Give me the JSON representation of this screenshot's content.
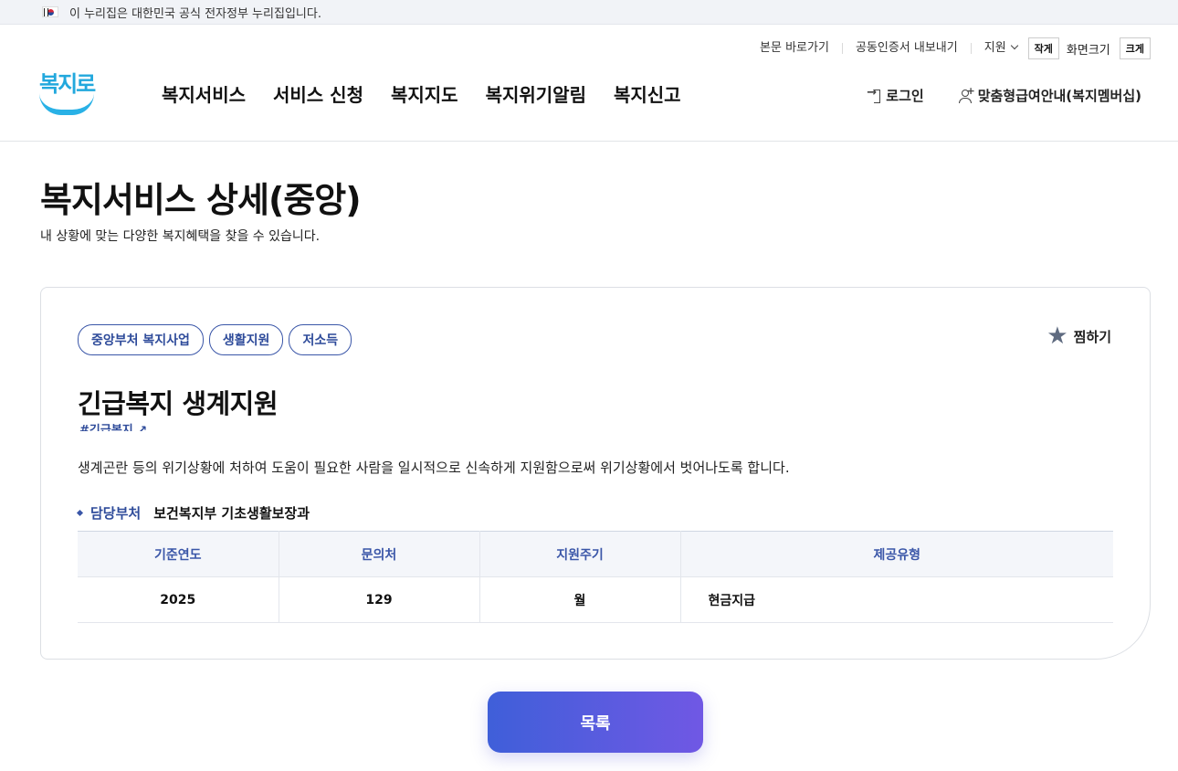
{
  "gov_banner": {
    "text": "이 누리집은 대한민국 공식 전자정부 누리집입니다."
  },
  "utility": {
    "skip": "본문 바로가기",
    "cert": "공동인증서 내보내기",
    "support": "지원",
    "small": "작게",
    "screen_size": "화면크기",
    "large": "크게"
  },
  "logo": {
    "text": "복지로"
  },
  "nav": [
    "복지서비스",
    "서비스 신청",
    "복지지도",
    "복지위기알림",
    "복지신고"
  ],
  "member": {
    "login": "로그인",
    "membership": "맞춤형급여안내(복지멤버십)"
  },
  "page": {
    "title": "복지서비스 상세(중앙)",
    "subtitle": "내 상황에 맞는 다양한 복지혜택을 찾을 수 있습니다."
  },
  "service": {
    "tags": [
      "중앙부처 복지사업",
      "생활지원",
      "저소득"
    ],
    "favorite": "찜하기",
    "title": "긴급복지 생계지원",
    "hashtag": "#긴급복지",
    "description": "생계곤란 등의 위기상황에 처하여 도움이 필요한 사람을 일시적으로 신속하게 지원함으로써 위기상황에서 벗어나도록 합니다.",
    "dept_label": "담당부처",
    "dept_value": "보건복지부 기초생활보장과",
    "table": {
      "headers": [
        "기준연도",
        "문의처",
        "지원주기",
        "제공유형"
      ],
      "row": [
        "2025",
        "129",
        "월",
        "현금지급"
      ]
    }
  },
  "list_button": "목록",
  "colors": {
    "accent": "#3a56a8",
    "button_start": "#3f5fd9",
    "button_end": "#7058e4",
    "logo": "#22a8dd"
  }
}
